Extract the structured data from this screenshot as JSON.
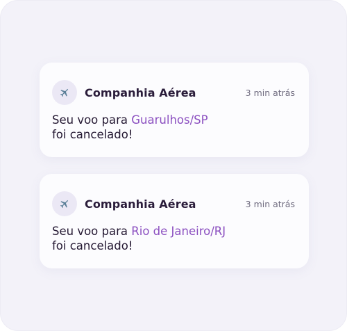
{
  "colors": {
    "panel_background": "#f3f2f9",
    "card_background": "#fcfcfe",
    "accent": "#8b4fc0",
    "text": "#241832",
    "icon_circle": "#ebe8f5",
    "icon_plane": "#5a7f97"
  },
  "notifications": [
    {
      "icon": "airplane-icon",
      "sender": "Companhia Aérea",
      "time": "3 min atrás",
      "message_prefix": "Seu voo para ",
      "destination": "Guarulhos/SP",
      "message_suffix": "foi cancelado!"
    },
    {
      "icon": "airplane-icon",
      "sender": "Companhia Aérea",
      "time": "3 min atrás",
      "message_prefix": "Seu voo para ",
      "destination": "Rio de Janeiro/RJ",
      "message_suffix": "foi cancelado!"
    }
  ]
}
